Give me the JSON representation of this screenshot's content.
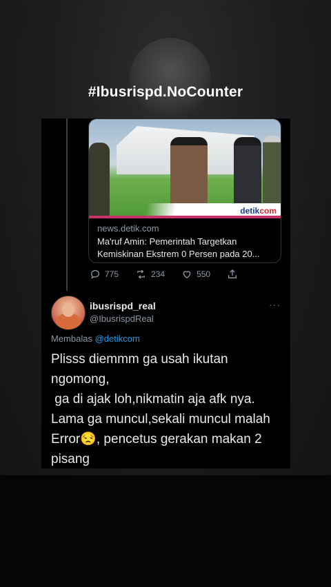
{
  "overlay": {
    "hashtag": "#Ibusrispd.NoCounter"
  },
  "link_card": {
    "domain": "news.detik.com",
    "title_line1": "Ma'ruf Amin: Pemerintah Targetkan",
    "title_line2": "Kemiskinan Ekstrem 0 Persen pada 20...",
    "logo_prefix": "detik",
    "logo_suffix": "com"
  },
  "stats": {
    "replies": "775",
    "retweets": "234",
    "likes": "550"
  },
  "reply": {
    "display_name": "ibusrispd_real",
    "handle": "@IbusrispdReal",
    "more": "···",
    "replying_prefix": "Membalas",
    "replying_to": "@detikcom",
    "text": "Plisss diemmm ga usah ikutan\nngomong,\n ga di ajak loh,nikmatin aja afk nya.\nLama ga muncul,sekali muncul malah\nError😒, pencetus gerakan makan 2\npisang"
  },
  "colors": {
    "accent": "#1d9bf0",
    "muted": "#8b98a5",
    "card_bg": "#000000"
  }
}
